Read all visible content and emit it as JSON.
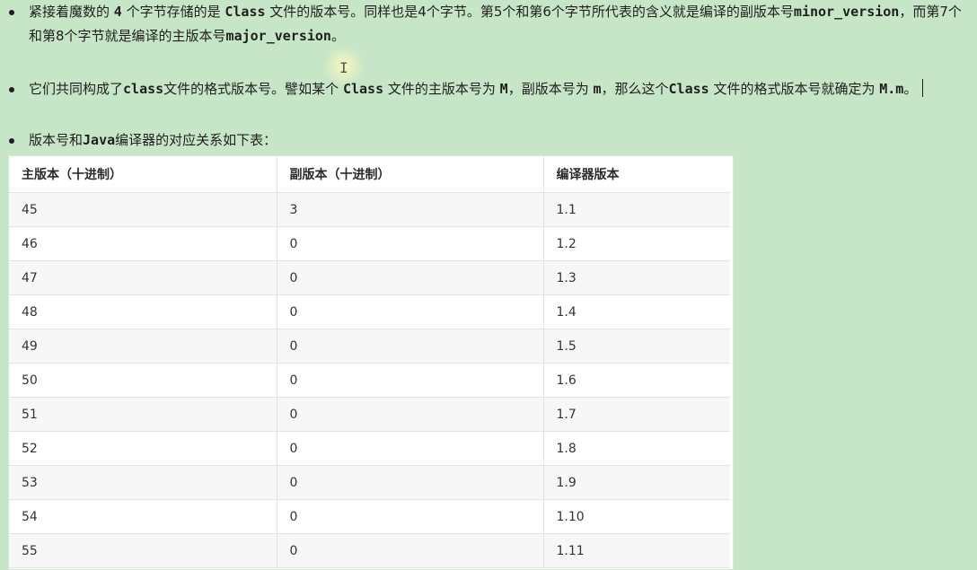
{
  "bullets": [
    {
      "parts": [
        {
          "t": "紧接着魔数的 "
        },
        {
          "t": "4",
          "mono": true
        },
        {
          "t": " 个字节存储的是 "
        },
        {
          "t": "Class",
          "mono": true
        },
        {
          "t": " 文件的版本号。同样也是4个字节。第5个和第6个字节所代表的含义就是编译的副版本号"
        },
        {
          "t": "minor_version",
          "mono": true
        },
        {
          "t": "，而第7个和第8个字节就是编译的主版本号"
        },
        {
          "t": "major_version",
          "mono": true
        },
        {
          "t": "。"
        }
      ]
    },
    {
      "parts": [
        {
          "t": "它们共同构成了"
        },
        {
          "t": "class",
          "mono": true
        },
        {
          "t": "文件的格式版本号。譬如某个 "
        },
        {
          "t": "Class",
          "mono": true
        },
        {
          "t": " 文件的主版本号为 "
        },
        {
          "t": "M",
          "mono": true
        },
        {
          "t": "，副版本号为 "
        },
        {
          "t": "m",
          "mono": true
        },
        {
          "t": "，那么这个"
        },
        {
          "t": "Class",
          "mono": true
        },
        {
          "t": " 文件的格式版本号就确定为 "
        },
        {
          "t": "M.m",
          "mono": true
        },
        {
          "t": "。"
        }
      ],
      "caret": true
    },
    {
      "parts": [
        {
          "t": "版本号和"
        },
        {
          "t": "Java",
          "mono": true
        },
        {
          "t": "编译器的对应关系如下表："
        }
      ]
    }
  ],
  "table": {
    "headers": [
      "主版本（十进制）",
      "副版本（十进制）",
      "编译器版本"
    ],
    "rows": [
      [
        "45",
        "3",
        "1.1"
      ],
      [
        "46",
        "0",
        "1.2"
      ],
      [
        "47",
        "0",
        "1.3"
      ],
      [
        "48",
        "0",
        "1.4"
      ],
      [
        "49",
        "0",
        "1.5"
      ],
      [
        "50",
        "0",
        "1.6"
      ],
      [
        "51",
        "0",
        "1.7"
      ],
      [
        "52",
        "0",
        "1.8"
      ],
      [
        "53",
        "0",
        "1.9"
      ],
      [
        "54",
        "0",
        "1.10"
      ],
      [
        "55",
        "0",
        "1.11"
      ]
    ]
  },
  "colors": {
    "background": "#c7e6c7",
    "table_bg": "#ffffff",
    "row_alt": "#f7f7f7"
  }
}
